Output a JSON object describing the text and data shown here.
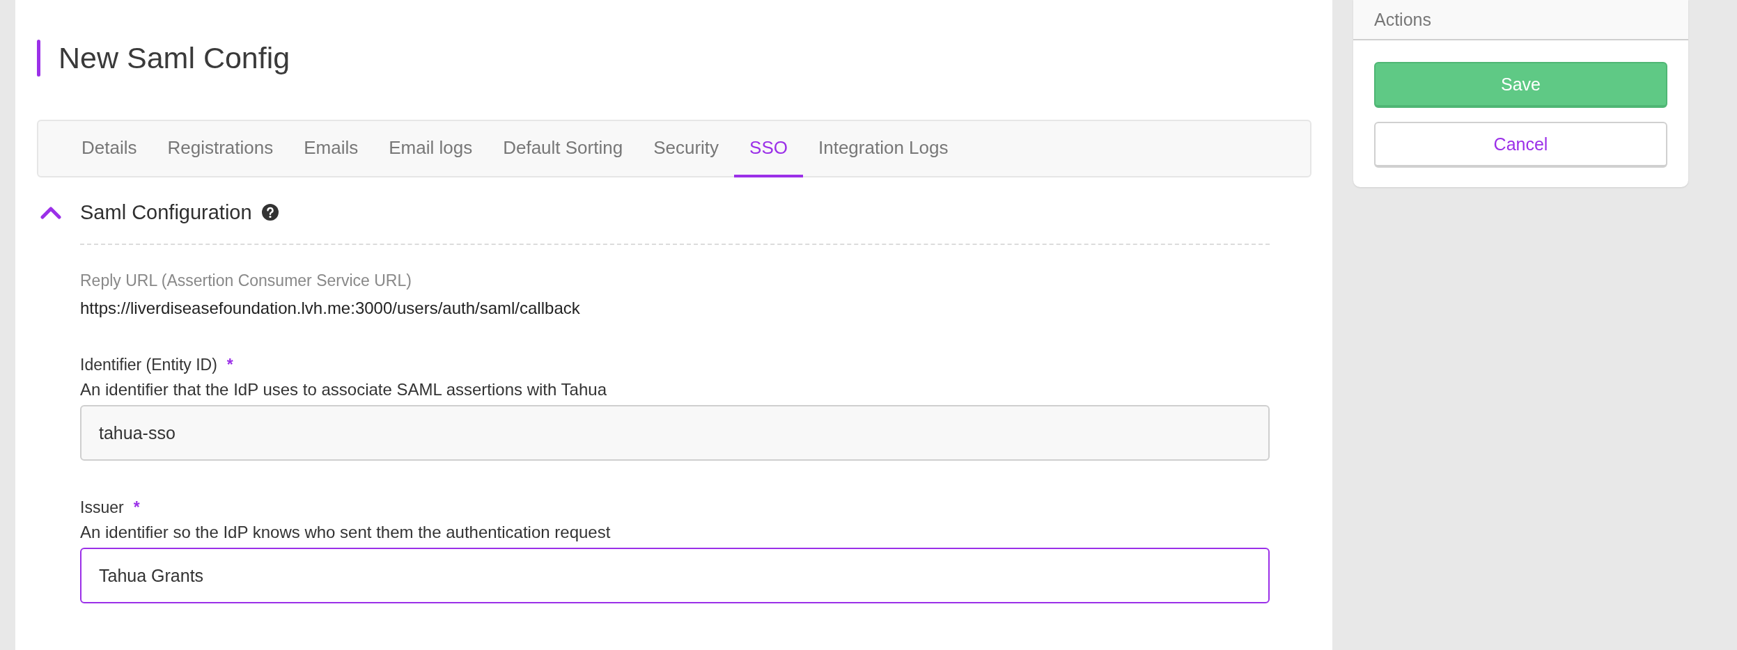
{
  "page": {
    "title": "New Saml Config"
  },
  "tabs": [
    {
      "label": "Details",
      "selected": false
    },
    {
      "label": "Registrations",
      "selected": false
    },
    {
      "label": "Emails",
      "selected": false
    },
    {
      "label": "Email logs",
      "selected": false
    },
    {
      "label": "Default Sorting",
      "selected": false
    },
    {
      "label": "Security",
      "selected": false
    },
    {
      "label": "SSO",
      "selected": true
    },
    {
      "label": "Integration Logs",
      "selected": false
    }
  ],
  "section": {
    "title": "Saml Configuration",
    "expanded": true
  },
  "fields": [
    {
      "kind": "display",
      "label": "Reply URL (Assertion Consumer Service URL)",
      "value": "https://liverdiseasefoundation.lvh.me:3000/users/auth/saml/callback"
    },
    {
      "kind": "input",
      "label": "Identifier (Entity ID)",
      "required": true,
      "required_mark": "*",
      "description": "An identifier that the IdP uses to associate SAML assertions with Tahua",
      "value": "tahua-sso",
      "focused": false
    },
    {
      "kind": "input",
      "label": "Issuer",
      "required": true,
      "required_mark": "*",
      "description": "An identifier so the IdP knows who sent them the authentication request",
      "value": "Tahua Grants",
      "focused": true
    }
  ],
  "actions": {
    "title": "Actions",
    "buttons": [
      {
        "kind": "primary",
        "label": "Save"
      },
      {
        "kind": "secondary",
        "label": "Cancel"
      }
    ]
  }
}
